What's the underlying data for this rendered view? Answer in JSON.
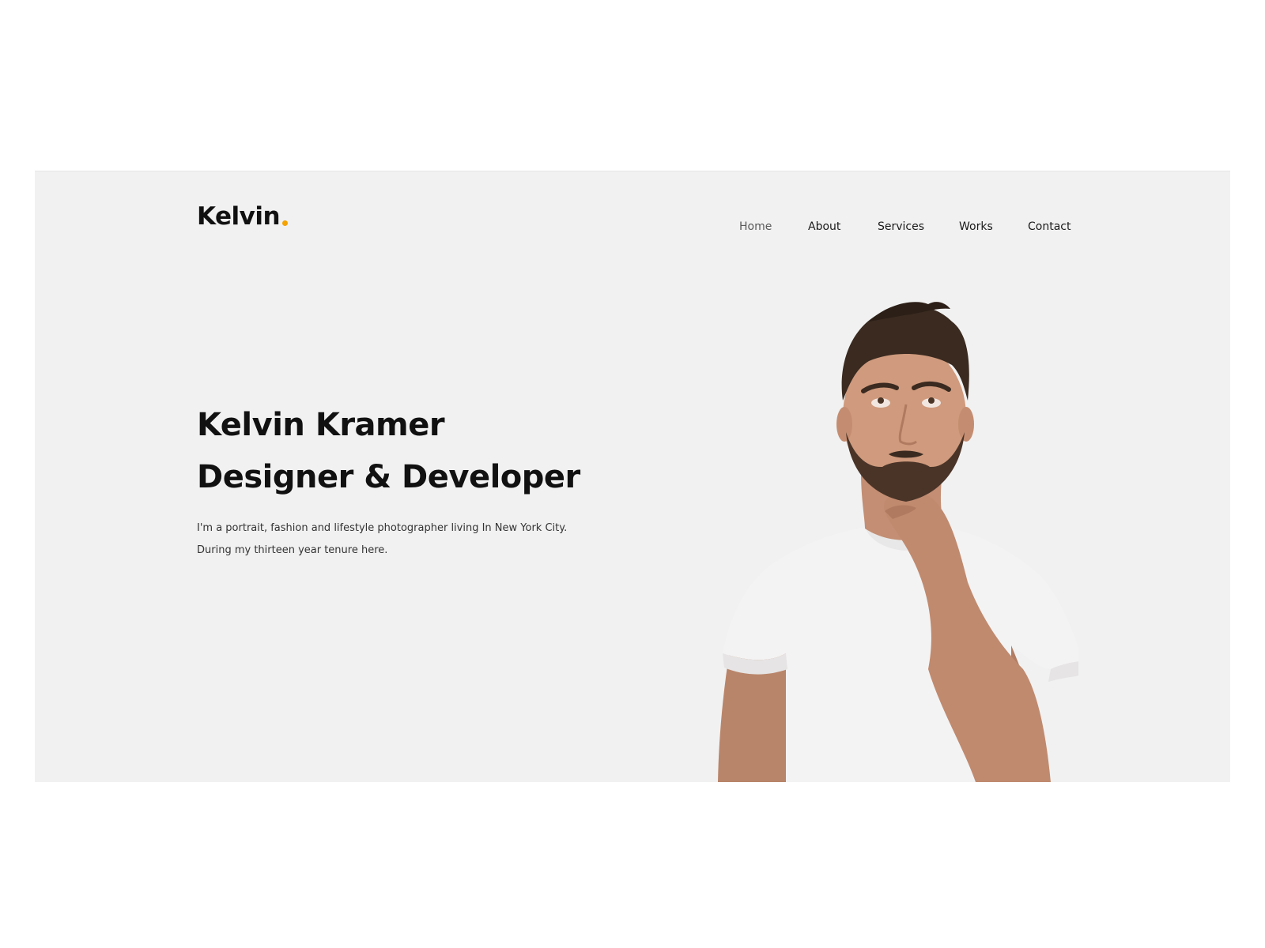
{
  "brand": {
    "name": "Kelvin",
    "accent_color": "#f5a300"
  },
  "nav": {
    "items": [
      {
        "label": "Home",
        "active": true
      },
      {
        "label": "About",
        "active": false
      },
      {
        "label": "Services",
        "active": false
      },
      {
        "label": "Works",
        "active": false
      },
      {
        "label": "Contact",
        "active": false
      }
    ]
  },
  "hero": {
    "title_line1": "Kelvin Kramer",
    "title_line2": "Designer & Developer",
    "bio_line1": "I'm a portrait, fashion and lifestyle photographer living In New York City.",
    "bio_line2": "During my thirteen year tenure here.",
    "background_color": "#f1f1f1",
    "portrait_icon": "man-thinking-portrait-photo"
  }
}
